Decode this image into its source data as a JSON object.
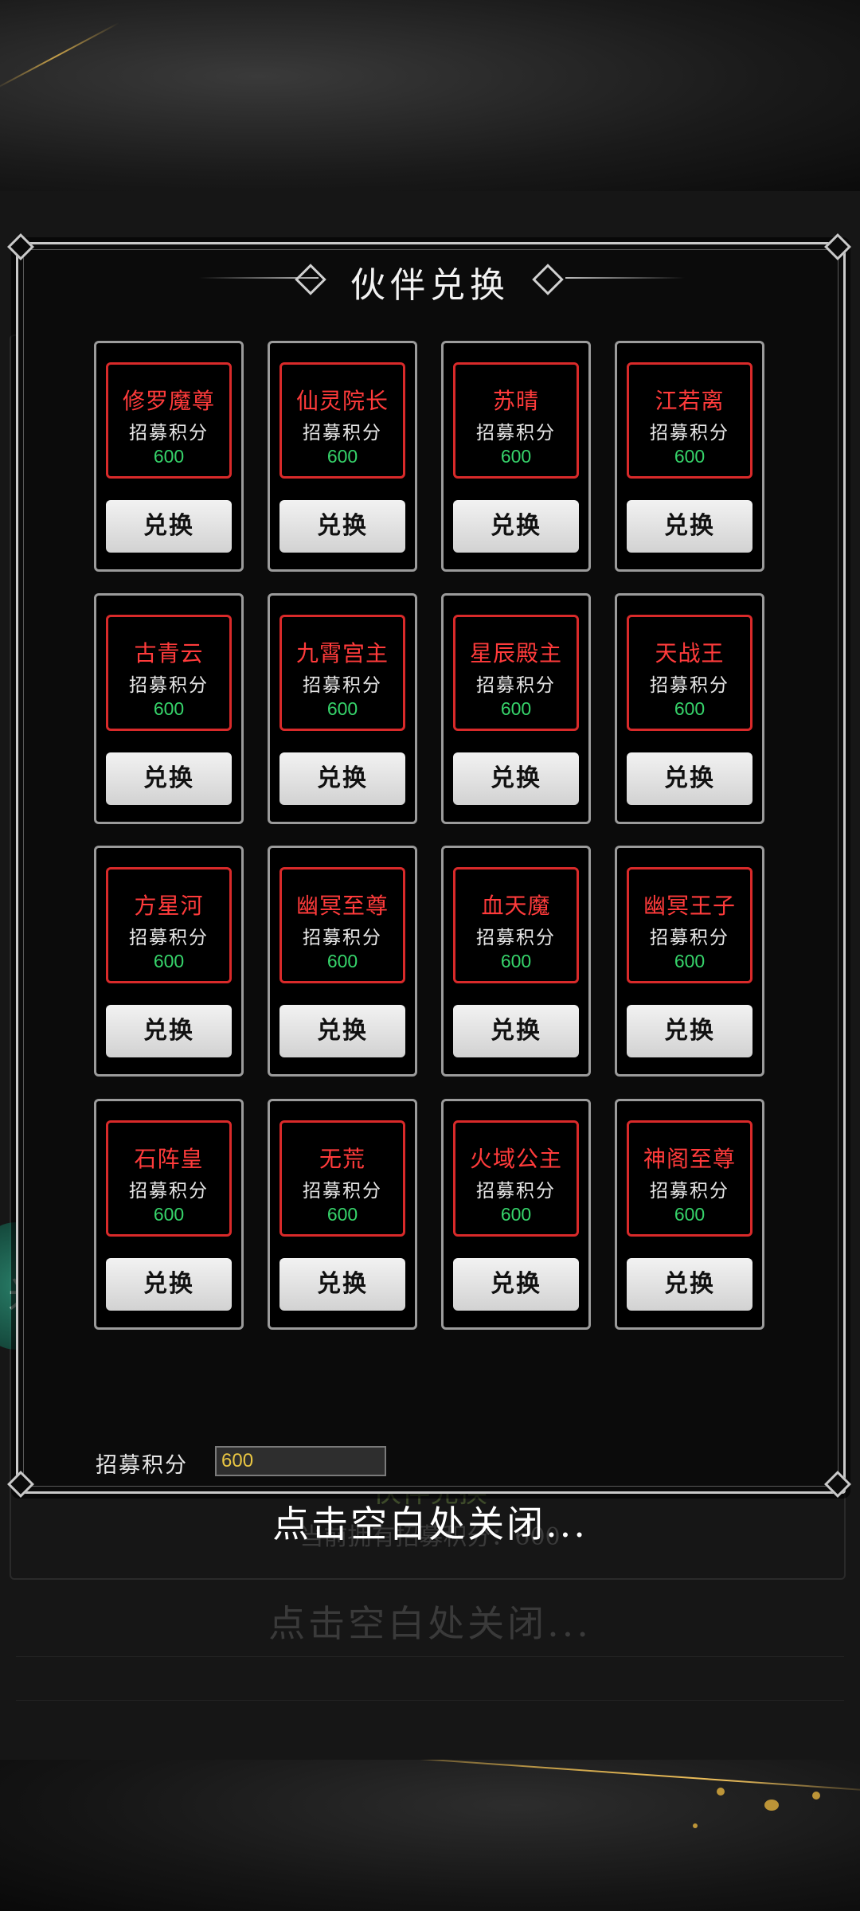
{
  "dialog": {
    "title": "伙伴兑换",
    "items": [
      {
        "name": "修罗魔尊",
        "label": "招募积分",
        "cost": "600",
        "button": "兑换"
      },
      {
        "name": "仙灵院长",
        "label": "招募积分",
        "cost": "600",
        "button": "兑换"
      },
      {
        "name": "苏晴",
        "label": "招募积分",
        "cost": "600",
        "button": "兑换"
      },
      {
        "name": "江若离",
        "label": "招募积分",
        "cost": "600",
        "button": "兑换"
      },
      {
        "name": "古青云",
        "label": "招募积分",
        "cost": "600",
        "button": "兑换"
      },
      {
        "name": "九霄宫主",
        "label": "招募积分",
        "cost": "600",
        "button": "兑换"
      },
      {
        "name": "星辰殿主",
        "label": "招募积分",
        "cost": "600",
        "button": "兑换"
      },
      {
        "name": "天战王",
        "label": "招募积分",
        "cost": "600",
        "button": "兑换"
      },
      {
        "name": "方星河",
        "label": "招募积分",
        "cost": "600",
        "button": "兑换"
      },
      {
        "name": "幽冥至尊",
        "label": "招募积分",
        "cost": "600",
        "button": "兑换"
      },
      {
        "name": "血天魔",
        "label": "招募积分",
        "cost": "600",
        "button": "兑换"
      },
      {
        "name": "幽冥王子",
        "label": "招募积分",
        "cost": "600",
        "button": "兑换"
      },
      {
        "name": "石阵皇",
        "label": "招募积分",
        "cost": "600",
        "button": "兑换"
      },
      {
        "name": "无荒",
        "label": "招募积分",
        "cost": "600",
        "button": "兑换"
      },
      {
        "name": "火域公主",
        "label": "招募积分",
        "cost": "600",
        "button": "兑换"
      },
      {
        "name": "神阁至尊",
        "label": "招募积分",
        "cost": "600",
        "button": "兑换"
      }
    ],
    "points_label": "招募积分",
    "points_value": "600",
    "close_hint": "点击空白处关闭..."
  },
  "background": {
    "title": "伙伴兑换",
    "sub": "当前拥有招募积分：600",
    "close_hint": "点击空白处关闭...",
    "side_button_icon": "米"
  },
  "colors": {
    "name_red": "#ff3b3b",
    "frame_red": "#d92a2a",
    "cost_green": "#36d36a",
    "points_yellow": "#e8c542"
  }
}
